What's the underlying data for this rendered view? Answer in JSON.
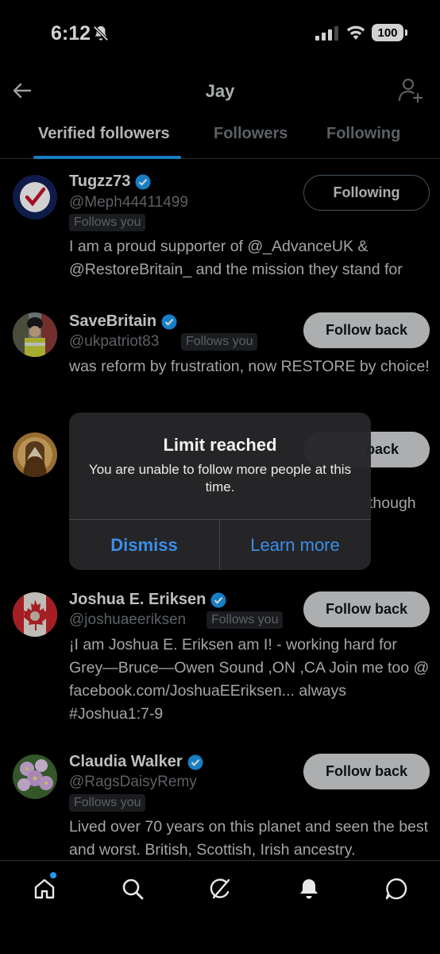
{
  "status_bar": {
    "time": "6:12",
    "battery": "100"
  },
  "header": {
    "title": "Jay"
  },
  "tabs": [
    {
      "label": "Verified followers",
      "active": true
    },
    {
      "label": "Followers",
      "active": false
    },
    {
      "label": "Following",
      "active": false
    }
  ],
  "followers": [
    {
      "name": "Tugzz73",
      "handle": "@Meph44411499",
      "follows_you": "Follows you",
      "bio": "I am a proud supporter of @_AdvanceUK & @RestoreBritain_ and the mission they stand for",
      "button": "Following"
    },
    {
      "name": "SaveBritain",
      "handle": "@ukpatriot83",
      "follows_you": "Follows you",
      "bio": "was reform by frustration, now RESTORE by choice!",
      "button": "Follow back"
    },
    {
      "name": "",
      "handle": "",
      "bio_fragment": "though",
      "button_fragment": "back"
    },
    {
      "name": "Joshua E. Eriksen",
      "handle": "@joshuaeeriksen",
      "follows_you": "Follows you",
      "bio": "¡I am Joshua E. Eriksen am I! - working hard for Grey—Bruce—Owen Sound ,ON ,CA Join me too @ facebook.com/JoshuaEEriksen... always #Joshua1:7-9",
      "button": "Follow back"
    },
    {
      "name": "Claudia Walker",
      "handle": "@RagsDaisyRemy",
      "follows_you": "Follows you",
      "bio": "Lived over 70 years on this planet and seen the best and worst. British, Scottish, Irish ancestry.",
      "button": "Follow back"
    }
  ],
  "alert": {
    "title": "Limit reached",
    "message": "You are unable to follow more people at this time.",
    "dismiss": "Dismiss",
    "learn_more": "Learn more"
  },
  "bottom_nav": {
    "items": [
      "home-icon",
      "search-icon",
      "grok-icon",
      "notifications-icon",
      "messages-icon"
    ]
  },
  "colors": {
    "accent": "#1d9bf0",
    "alert_button": "#3a8eea",
    "background": "#000000",
    "secondary_text": "#71767b"
  }
}
